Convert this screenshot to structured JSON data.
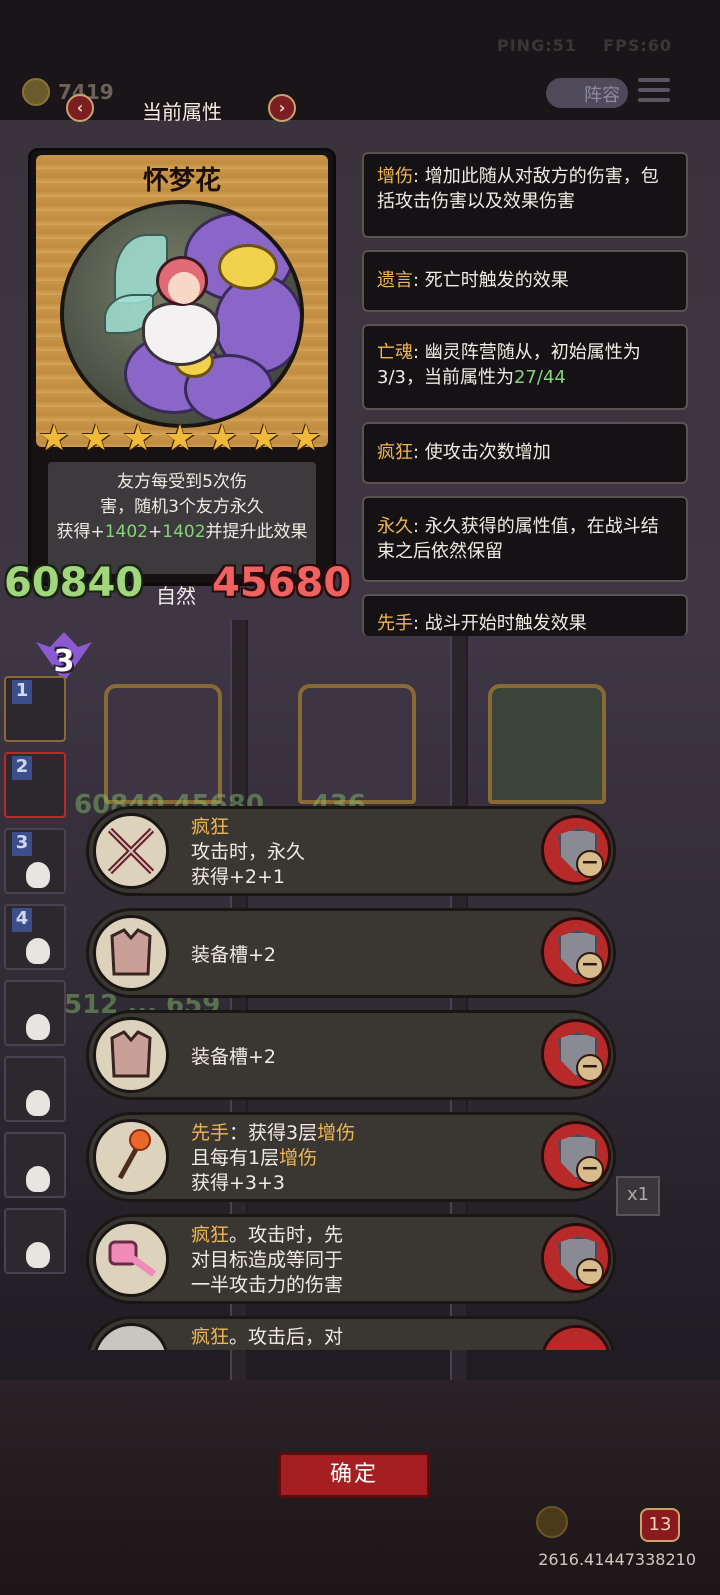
{
  "status": {
    "ping": "PING:51",
    "fps": "FPS:60"
  },
  "top": {
    "coins": "7419",
    "formation_label": "阵容"
  },
  "header": {
    "title": "当前属性",
    "prev": "‹",
    "next": "›"
  },
  "card": {
    "name": "怀梦花",
    "star_count": 7,
    "desc_line1": "友方每受到5次伤",
    "desc_line2": "害，随机3个友方永久",
    "desc_prefix": "获得+",
    "desc_val1": "1402",
    "desc_plus": "+",
    "desc_val2": "1402",
    "desc_suffix": "并提升此效果",
    "attack": "60840",
    "tribe": "自然",
    "health": "45680",
    "tier": "3"
  },
  "keywords": [
    {
      "name": "增伤",
      "text": ": 增加此随从对敌方的伤害，包括攻击伤害以及效果伤害"
    },
    {
      "name": "遗言",
      "text": ": 死亡时触发的效果"
    },
    {
      "name": "亡魂",
      "text": ": 幽灵阵营随从，初始属性为3/3，当前属性为",
      "extra": "27/44"
    },
    {
      "name": "疯狂",
      "text": ": 使攻击次数增加"
    },
    {
      "name": "永久",
      "text": ": 永久获得的属性值，在战斗结束之后依然保留"
    },
    {
      "name": "先手",
      "text": ": 战斗开始时触发效果"
    }
  ],
  "board": {
    "slots": [
      "1",
      "2",
      "3",
      "4"
    ],
    "card_stats_row1": "60840 45680 ... 436",
    "card_stats_row2": "512 ... 659",
    "speed": "x1"
  },
  "equipment": [
    {
      "kw": "疯狂",
      "line1": "攻击时，永久",
      "line2": "获得+2+1",
      "icon": "crossed-swords-icon"
    },
    {
      "line1": "装备槽+2",
      "icon": "armor-icon"
    },
    {
      "line1": "装备槽+2",
      "icon": "armor-icon"
    },
    {
      "kw": "先手",
      "kw_sep": "：获得3层",
      "kw2": "增伤",
      "line2a": "且每有1层",
      "line2kw": "增伤",
      "line3": "获得+3+3",
      "icon": "torch-icon"
    },
    {
      "kw": "疯狂",
      "line1_suffix": "。攻击时，先",
      "line2": "对目标造成等同于",
      "line3": "一半攻击力的伤害",
      "icon": "hammer-icon"
    },
    {
      "kw": "疯狂",
      "line1_suffix": "。攻击后，对",
      "icon": "blade-icon"
    }
  ],
  "confirm_label": "确定",
  "bottom": {
    "badge": "13",
    "debug": "2616.41447338210"
  },
  "colors": {
    "keyword": "#f0b654",
    "positive": "#88d27a",
    "health": "#f06262",
    "button_red": "#a41e22"
  }
}
